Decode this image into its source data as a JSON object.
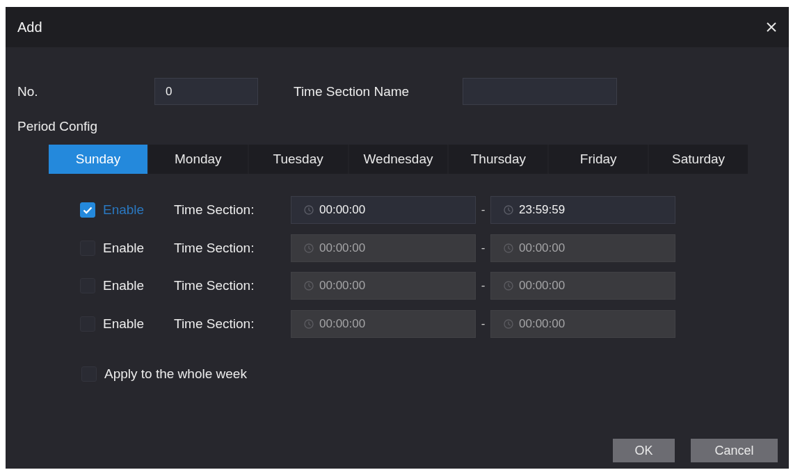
{
  "window": {
    "title": "Add"
  },
  "form": {
    "number": {
      "label": "No.",
      "value": "0"
    },
    "name": {
      "label": "Time Section Name"
    }
  },
  "period_config": {
    "label": "Period Config",
    "tabs": [
      {
        "label": "Sunday",
        "selected": true
      },
      {
        "label": "Monday",
        "selected": false
      },
      {
        "label": "Tuesday",
        "selected": false
      },
      {
        "label": "Wednesday",
        "selected": false
      },
      {
        "label": "Thursday",
        "selected": false
      },
      {
        "label": "Friday",
        "selected": false
      },
      {
        "label": "Saturday",
        "selected": false
      }
    ]
  },
  "sections": [
    {
      "checked": true,
      "checkbox_label": "Enable",
      "label": "Time Section:",
      "start": "00:00:00",
      "separator": "-",
      "end": "23:59:59"
    },
    {
      "checked": false,
      "checkbox_label": "Enable",
      "label": "Time Section:",
      "start": "00:00:00",
      "separator": "-",
      "end": "00:00:00"
    },
    {
      "checked": false,
      "checkbox_label": "Enable",
      "label": "Time Section:",
      "start": "00:00:00",
      "separator": "-",
      "end": "00:00:00"
    },
    {
      "checked": false,
      "checkbox_label": "Enable",
      "label": "Time Section:",
      "start": "00:00:00",
      "separator": "-",
      "end": "00:00:00"
    }
  ],
  "apply_whole_week": {
    "label": "Apply to the whole week",
    "checked": false
  },
  "buttons": [
    "OK",
    "Cancel"
  ]
}
